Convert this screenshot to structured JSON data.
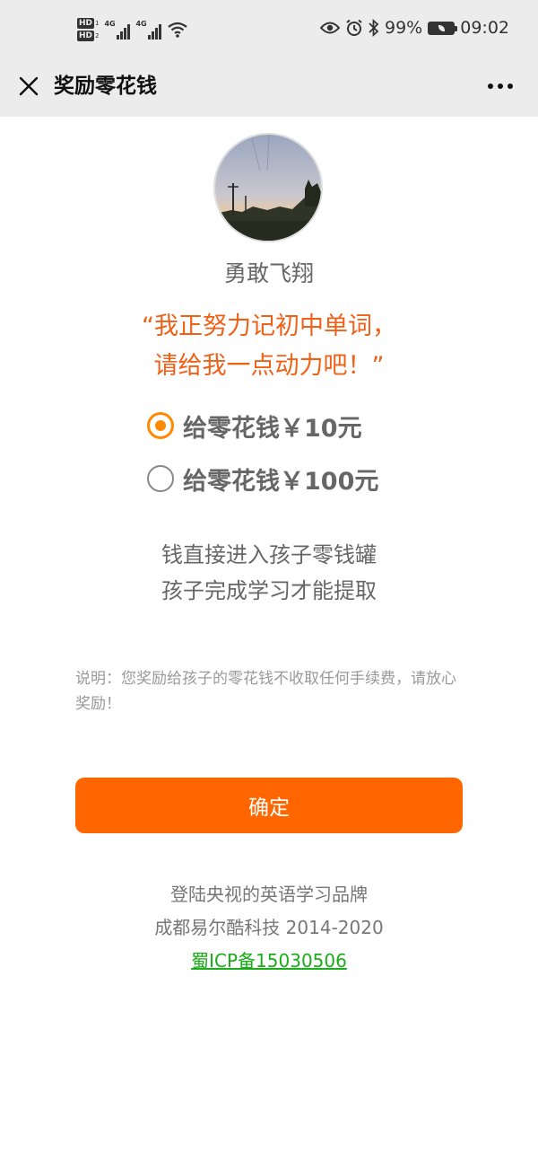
{
  "status_bar": {
    "left_badges": [
      {
        "label": "HD",
        "sub": "1"
      },
      {
        "label": "HD",
        "sub": "2"
      }
    ],
    "network_labels": [
      "4G",
      "4G"
    ],
    "battery": "99%",
    "time": "09:02",
    "icons": [
      "eye-icon",
      "alarm-icon",
      "bluetooth-icon",
      "battery-icon",
      "wifi-icon",
      "signal-icon"
    ]
  },
  "title_bar": {
    "title": "奖励零花钱"
  },
  "profile": {
    "nickname": "勇敢飞翔"
  },
  "quote": {
    "line1": "“我正努力记初中单词，",
    "line2": "请给我一点动力吧！”"
  },
  "options": [
    {
      "label": "给零花钱￥10元",
      "selected": true
    },
    {
      "label": "给零花钱￥100元",
      "selected": false
    }
  ],
  "info": {
    "line1": "钱直接进入孩子零钱罐",
    "line2": "孩子完成学习才能提取"
  },
  "note": "说明：您奖励给孩子的零花钱不收取任何手续费，请放心奖励！",
  "confirm_label": "确定",
  "footer": {
    "line1": "登陆央视的英语学习品牌",
    "line2": "成都易尔酷科技 2014-2020",
    "icp": "蜀ICP备15030506"
  },
  "colors": {
    "accent": "#ff6600",
    "radio": "#ff8a00",
    "quote": "#f06016",
    "link": "#1aad19"
  }
}
